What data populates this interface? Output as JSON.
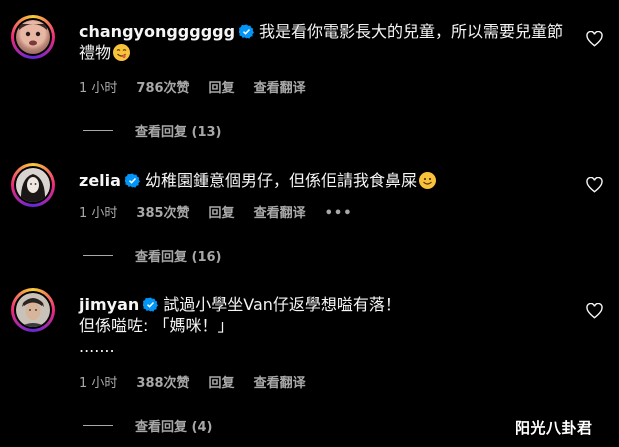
{
  "colors": {
    "background": "#000000",
    "text": "#f5f5f5",
    "muted": "#a8a8a8",
    "verified": "#0095f6"
  },
  "comments": [
    {
      "username": "changyongggggg",
      "text": "我是看你電影長大的兒童，所以需要兒童節",
      "text_line2": "禮物",
      "time": "1 小时",
      "likes": "786次赞",
      "reply": "回复",
      "translate": "查看翻译",
      "view_replies": "查看回复 (13)"
    },
    {
      "username": "zelia",
      "text": "幼稚園鍾意個男仔，但係佢請我食鼻屎",
      "time": "1 小时",
      "likes": "385次赞",
      "reply": "回复",
      "translate": "查看翻译",
      "more": "•••",
      "view_replies": "查看回复 (16)"
    },
    {
      "username": "jimyan",
      "text": "試過小學坐Van仔返學想嗌有落！",
      "text_line2": "但係嗌咗: 「媽咪！」",
      "text_line3": ".......",
      "time": "1 小时",
      "likes": "388次赞",
      "reply": "回复",
      "translate": "查看翻译",
      "view_replies": "查看回复 (4)"
    }
  ],
  "icons": {
    "verified": "verified-badge-icon",
    "like": "heart-outline-icon"
  },
  "watermark": "阳光八卦君"
}
